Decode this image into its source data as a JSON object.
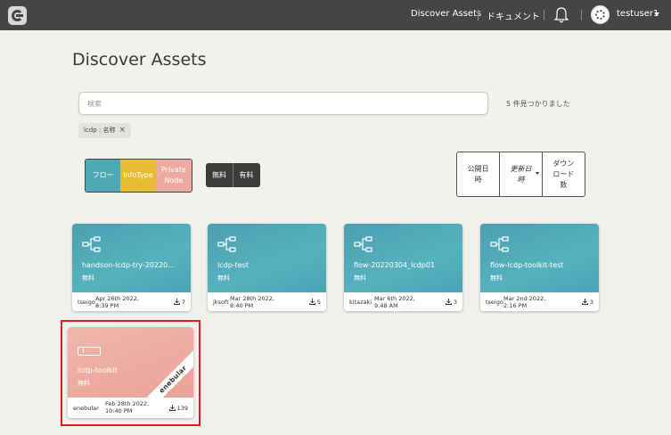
{
  "topbar": {
    "nav_discover": "Discover Assets",
    "nav_docs": "ドキュメント",
    "username": "testuser1",
    "icons": [
      "enebular-logo-icon",
      "bell-icon",
      "avatar-icon",
      "caret-down-icon"
    ]
  },
  "page_title": "Discover Assets",
  "search": {
    "placeholder": "検索",
    "value": ""
  },
  "result_count": "5 件見つかりました",
  "filter_tag": {
    "label": "lcdp : 名称",
    "remove": "×"
  },
  "type_filters": [
    "フロー",
    "InfoType",
    "Private Node"
  ],
  "price_filters": [
    "無料",
    "有料"
  ],
  "sort_options": [
    "公開日時",
    "更新日時",
    "ダウンロード数"
  ],
  "colors": {
    "topbar": "#464543",
    "flow_card": "#4fa9b5",
    "node_card": "#eeada1",
    "infotype": "#e7bb32",
    "highlight": "#e3191d"
  },
  "cards": [
    {
      "title": "handson-lcdp-try-20220...",
      "price": "無料",
      "author": "tseigo",
      "date": "Apr 26th 2022, 8:39 PM",
      "downloads": "7",
      "kind": "flow"
    },
    {
      "title": "lcdp-test",
      "price": "無料",
      "author": "jksoft",
      "date": "Mar 28th 2022, 8:40 PM",
      "downloads": "5",
      "kind": "flow"
    },
    {
      "title": "flow-20220304_lcdp01",
      "price": "無料",
      "author": "kitazaki",
      "date": "Mar 6th 2022, 9:48 AM",
      "downloads": "3",
      "kind": "flow"
    },
    {
      "title": "flow-lcdp-toolkit-test",
      "price": "無料",
      "author": "tseigo",
      "date": "Mar 2nd 2022, 2:16 PM",
      "downloads": "3",
      "kind": "flow"
    },
    {
      "title": "lcdp-toolkit",
      "price": "無料",
      "author": "enebular",
      "date": "Feb 28th 2022, 10:40 PM",
      "downloads": "139",
      "kind": "private-node",
      "ribbon": "enebular"
    }
  ]
}
